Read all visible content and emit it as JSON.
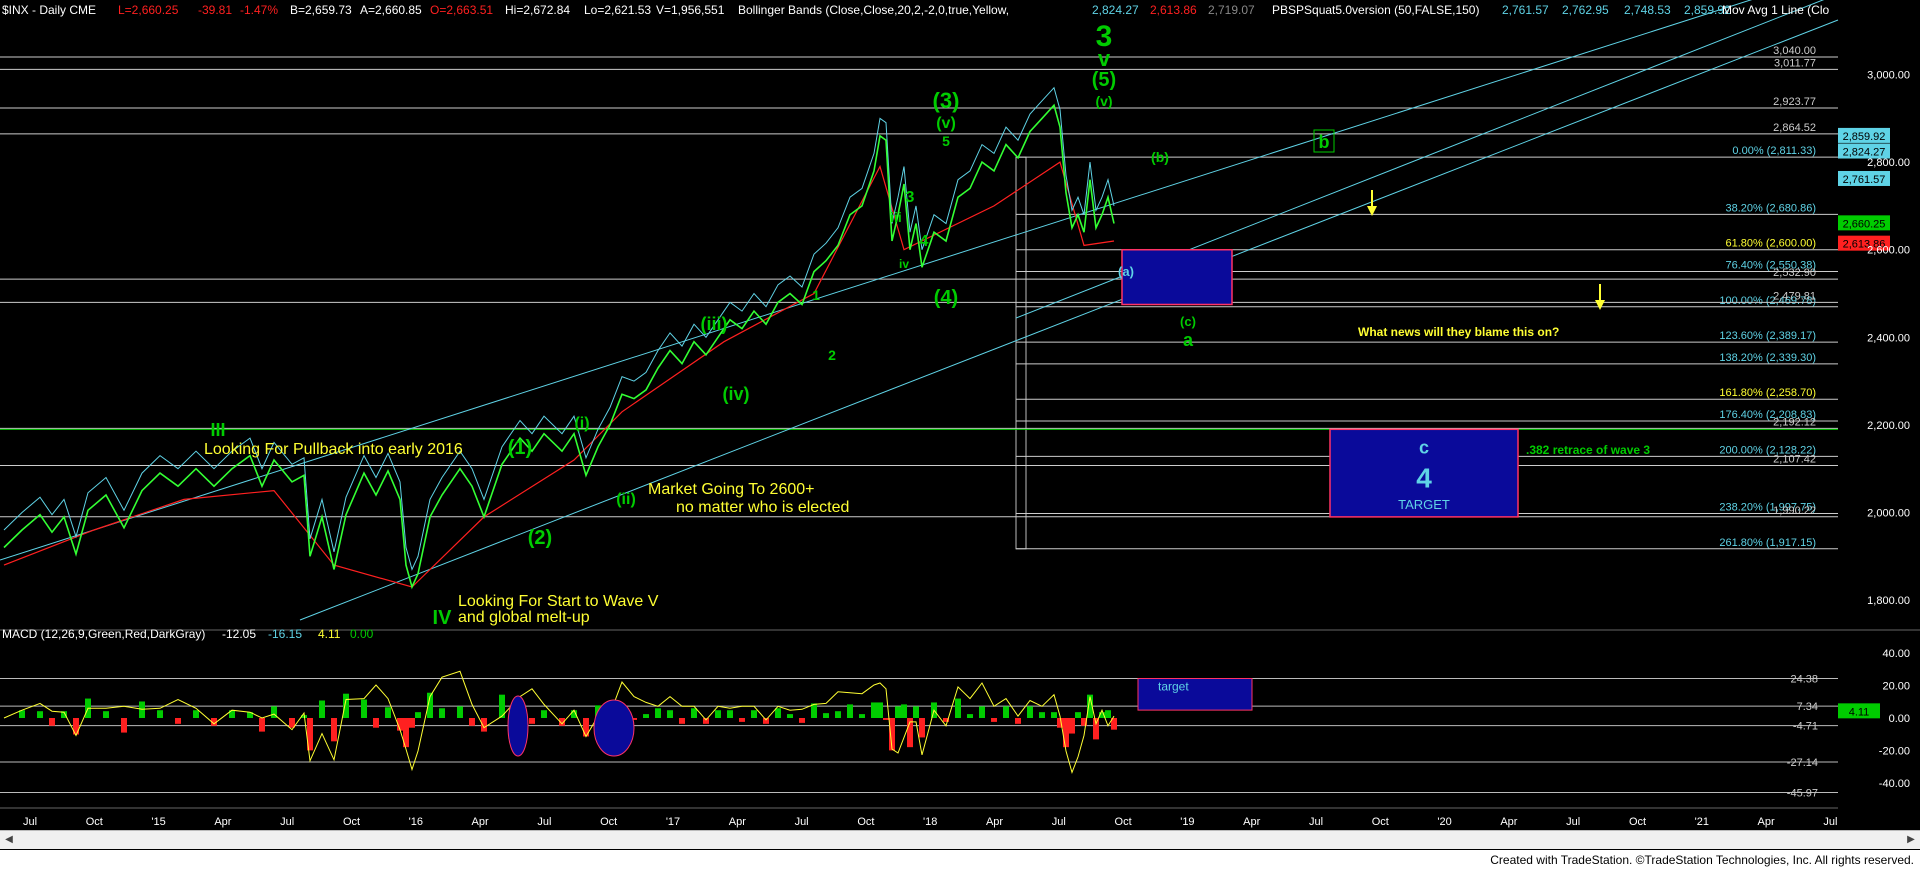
{
  "header": {
    "symbol": "$INX - Daily  CME",
    "last": "L=2,660.25",
    "change": "-39.81",
    "pct": "-1.47%",
    "bid": "B=2,659.73",
    "ask": "A=2,660.85",
    "open": "O=2,663.51",
    "high": "Hi=2,672.84",
    "low": "Lo=2,621.53",
    "vol": "V=1,956,551",
    "bb": "Bollinger Bands (Close,Close,20,2,-2,0,true,Yellow,",
    "bb_vals": [
      "2,824.27",
      "2,613.86",
      "2,719.07"
    ],
    "ind": "PBSPSquat5.0version (50,FALSE,150)",
    "ind_vals": [
      "2,761.57",
      "2,762.95",
      "2,748.53",
      "2,859.92"
    ],
    "ma": "Mov Avg 1 Line (Clo"
  },
  "macd_header": {
    "label": "MACD (12,26,9,Green,Red,DarkGray)",
    "v1": "-12.05",
    "v2": "-16.15",
    "v3": "4.11",
    "v4": "0.00"
  },
  "footer": "Created with TradeStation. ©TradeStation Technologies, Inc. All rights reserved.",
  "colors": {
    "green": "#00cc00",
    "price_line": "#33ff33",
    "red": "#ff2020",
    "yellow": "#ffff33",
    "cyan": "#5fd3e6",
    "blue_box": "#0a0a9a"
  },
  "chart_data": [
    {
      "type": "line",
      "title": "$INX - Daily",
      "x_ticks": [
        "Jul",
        "Oct",
        "'15",
        "Apr",
        "Jul",
        "Oct",
        "'16",
        "Apr",
        "Jul",
        "Oct",
        "'17",
        "Apr",
        "Jul",
        "Oct",
        "'18",
        "Apr",
        "Jul",
        "Oct",
        "'19",
        "Apr",
        "Jul",
        "Oct",
        "'20",
        "Apr",
        "Jul",
        "Oct",
        "'21",
        "Apr",
        "Jul"
      ],
      "y_ticks": [
        "3,000.00",
        "2,800.00",
        "2,600.00",
        "2,400.00",
        "2,200.00",
        "2,000.00",
        "1,800.00"
      ],
      "ylim": [
        1750,
        3120
      ],
      "series": [
        {
          "values": [
            [
              0,
              1920
            ],
            [
              6,
              1960
            ],
            [
              12,
              1995
            ],
            [
              16,
              1955
            ],
            [
              20,
              1990
            ],
            [
              24,
              1905
            ],
            [
              28,
              2005
            ],
            [
              34,
              2040
            ],
            [
              40,
              1965
            ],
            [
              46,
              2050
            ],
            [
              52,
              2090
            ],
            [
              58,
              2060
            ],
            [
              64,
              2100
            ],
            [
              70,
              2060
            ],
            [
              76,
              2100
            ],
            [
              82,
              2130
            ],
            [
              86,
              2060
            ],
            [
              90,
              2120
            ],
            [
              96,
              2070
            ],
            [
              100,
              2085
            ],
            [
              102,
              1900
            ],
            [
              106,
              1990
            ],
            [
              110,
              1870
            ],
            [
              114,
              1995
            ],
            [
              120,
              2090
            ],
            [
              124,
              2040
            ],
            [
              128,
              2095
            ],
            [
              132,
              2030
            ],
            [
              134,
              1880
            ],
            [
              136,
              1830
            ],
            [
              138,
              1860
            ],
            [
              142,
              1990
            ],
            [
              146,
              2040
            ],
            [
              152,
              2100
            ],
            [
              156,
              2060
            ],
            [
              160,
              1990
            ],
            [
              166,
              2110
            ],
            [
              172,
              2170
            ],
            [
              176,
              2140
            ],
            [
              180,
              2180
            ],
            [
              186,
              2140
            ],
            [
              190,
              2180
            ],
            [
              194,
              2085
            ],
            [
              198,
              2150
            ],
            [
              202,
              2200
            ],
            [
              206,
              2270
            ],
            [
              210,
              2260
            ],
            [
              214,
              2280
            ],
            [
              218,
              2330
            ],
            [
              222,
              2370
            ],
            [
              226,
              2340
            ],
            [
              230,
              2390
            ],
            [
              234,
              2360
            ],
            [
              238,
              2400
            ],
            [
              242,
              2440
            ],
            [
              246,
              2420
            ],
            [
              250,
              2460
            ],
            [
              254,
              2430
            ],
            [
              258,
              2480
            ],
            [
              262,
              2500
            ],
            [
              266,
              2475
            ],
            [
              270,
              2550
            ],
            [
              274,
              2575
            ],
            [
              278,
              2610
            ],
            [
              282,
              2680
            ],
            [
              286,
              2700
            ],
            [
              290,
              2780
            ],
            [
              292,
              2860
            ],
            [
              294,
              2850
            ],
            [
              296,
              2620
            ],
            [
              298,
              2680
            ],
            [
              300,
              2750
            ],
            [
              302,
              2600
            ],
            [
              304,
              2660
            ],
            [
              306,
              2560
            ],
            [
              310,
              2640
            ],
            [
              314,
              2620
            ],
            [
              318,
              2720
            ],
            [
              322,
              2740
            ],
            [
              326,
              2800
            ],
            [
              330,
              2780
            ],
            [
              334,
              2840
            ],
            [
              338,
              2810
            ],
            [
              342,
              2870
            ],
            [
              346,
              2900
            ],
            [
              350,
              2930
            ],
            [
              352,
              2880
            ],
            [
              354,
              2730
            ],
            [
              356,
              2650
            ],
            [
              358,
              2680
            ],
            [
              360,
              2640
            ],
            [
              362,
              2760
            ],
            [
              364,
              2650
            ],
            [
              366,
              2680
            ],
            [
              368,
              2720
            ],
            [
              370,
              2660
            ]
          ]
        },
        {
          "name": "",
          "values": [
            [
              0,
              1880
            ],
            [
              30,
              1960
            ],
            [
              60,
              2030
            ],
            [
              90,
              2050
            ],
            [
              110,
              1880
            ],
            [
              136,
              1830
            ],
            [
              160,
              1990
            ],
            [
              190,
              2120
            ],
            [
              206,
              2230
            ],
            [
              240,
              2390
            ],
            [
              270,
              2500
            ],
            [
              292,
              2790
            ],
            [
              300,
              2600
            ],
            [
              330,
              2700
            ],
            [
              352,
              2800
            ],
            [
              360,
              2610
            ],
            [
              370,
              2620
            ]
          ]
        }
      ],
      "annotations": [
        {
          "text": "3",
          "color": "green"
        },
        {
          "text": "v",
          "color": "green"
        },
        {
          "text": "(5)",
          "color": "green"
        },
        {
          "text": "(v)",
          "color": "green"
        },
        {
          "text": "(3)",
          "color": "green"
        },
        {
          "text": "(v)",
          "color": "green"
        },
        {
          "text": "5",
          "color": "green"
        },
        {
          "text": "3",
          "color": "green"
        },
        {
          "text": "4",
          "color": "green"
        },
        {
          "text": "iii",
          "color": "green"
        },
        {
          "text": "iv",
          "color": "green"
        },
        {
          "text": "(4)",
          "color": "green"
        },
        {
          "text": "(b)",
          "color": "green"
        },
        {
          "text": "(a)",
          "color": "cyan"
        },
        {
          "text": "(c)",
          "color": "green"
        },
        {
          "text": "a",
          "color": "green"
        },
        {
          "text": "b",
          "color": "green"
        },
        {
          "text": "(iii)",
          "color": "green"
        },
        {
          "text": "(iv)",
          "color": "green"
        },
        {
          "text": "1",
          "color": "green"
        },
        {
          "text": "2",
          "color": "green"
        },
        {
          "text": "III",
          "color": "green"
        },
        {
          "text": "(1)",
          "color": "green"
        },
        {
          "text": "(i)",
          "color": "green"
        },
        {
          "text": "(ii)",
          "color": "green"
        },
        {
          "text": "(2)",
          "color": "green"
        },
        {
          "text": "IV",
          "color": "green"
        }
      ],
      "notes": [
        "Looking For Pullback into early 2016",
        "Market Going To 2600+",
        "no matter who is elected",
        "Looking For Start to Wave V",
        "and global melt-up",
        "What news will they blame this on?",
        ".382 retrace of wave 3"
      ],
      "target_box": {
        "wave": "c",
        "number": "4",
        "label": "TARGET",
        "range": [
          1990,
          2190
        ]
      },
      "fib_levels": [
        {
          "label": "0.00% (2,811.33)",
          "value": 2811.33
        },
        {
          "label": "38.20% (2,680.86)",
          "value": 2680.86
        },
        {
          "label": "61.80% (2,600.00)",
          "value": 2600.0
        },
        {
          "label": "76.40% (2,550.38)",
          "value": 2550.38
        },
        {
          "label": "100.00% (2,469.78)",
          "value": 2469.78
        },
        {
          "label": "123.60% (2,389.17)",
          "value": 2389.17
        },
        {
          "label": "138.20% (2,339.30)",
          "value": 2339.3
        },
        {
          "label": "161.80% (2,258.70)",
          "value": 2258.7
        },
        {
          "label": "176.40% (2,208.83)",
          "value": 2208.83
        },
        {
          "label": "200.00% (2,128.22)",
          "value": 2128.22
        },
        {
          "label": "238.20% (1,997.75)",
          "value": 1997.75
        },
        {
          "label": "261.80% (1,917.15)",
          "value": 1917.15
        }
      ],
      "horizontal_levels": [
        "3,040.00",
        "3,011.77",
        "2,923.77",
        "2,864.52",
        "2,532.90",
        "2,479.81",
        "2,192.12",
        "2,107.42",
        "1,990.22"
      ],
      "price_tags": [
        {
          "text": "2,859.92",
          "color": "#5fd3e6"
        },
        {
          "text": "2,824.27",
          "color": "#5fd3e6"
        },
        {
          "text": "2,761.57",
          "color": "#5fd3e6"
        },
        {
          "text": "2,660.25",
          "color": "#00cc00"
        },
        {
          "text": "2,613.86",
          "color": "#ff2020"
        }
      ]
    },
    {
      "type": "bar",
      "title": "MACD (12,26,9,Green,Red,DarkGray)",
      "y_ticks": [
        "40.00",
        "20.00",
        "0.00",
        "-20.00",
        "-40.00"
      ],
      "ylim": [
        -52,
        52
      ],
      "levels": [
        "24.38",
        "7.34",
        "-4.71",
        "-27.14",
        "-45.97"
      ],
      "last_value": "4.11",
      "box_label": "target"
    }
  ]
}
